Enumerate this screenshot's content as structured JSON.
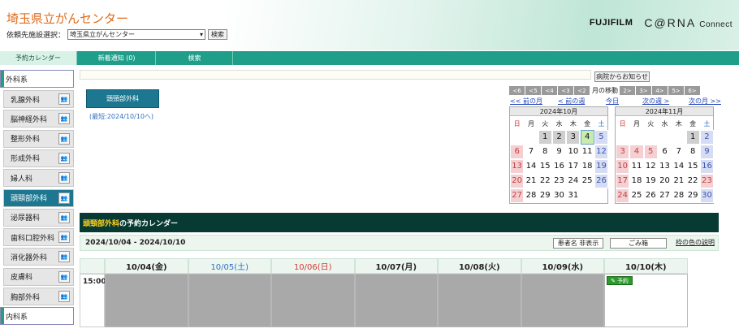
{
  "header": {
    "title": "埼玉県立がんセンター",
    "facility_label": "依頼先施設選択：",
    "facility_value": "埼玉県立がんセンター",
    "search_button": "検索",
    "logo_fujifilm": "FUJIFILM",
    "logo_corna": "C@RNA",
    "logo_connect": "Connect"
  },
  "tabs": [
    {
      "label": "予約カレンダー",
      "active": true
    },
    {
      "label": "新着通知 (0)",
      "active": false
    },
    {
      "label": "検索",
      "active": false
    }
  ],
  "sidebar": {
    "category_surgery": "外科系",
    "items": [
      {
        "label": "乳腺外科",
        "icon": "doctor-icon"
      },
      {
        "label": "脳神経外科",
        "icon": "doctor-icon"
      },
      {
        "label": "整形外科",
        "icon": "doctor-icon"
      },
      {
        "label": "形成外科",
        "icon": "doctor-icon"
      },
      {
        "label": "婦人科",
        "icon": "doctor-icon"
      },
      {
        "label": "頭頸部外科",
        "icon": "doctor-icon",
        "active": true
      },
      {
        "label": "泌尿器科",
        "icon": "doctor-icon"
      },
      {
        "label": "歯科口腔外科",
        "icon": "doctor-icon"
      },
      {
        "label": "消化器外科",
        "icon": "doctor-icon"
      },
      {
        "label": "皮膚科",
        "icon": "doctor-icon"
      },
      {
        "label": "胸部外科",
        "icon": "doctor-icon"
      }
    ],
    "category_internal": "内科系"
  },
  "notice_button": "病院からお知らせ",
  "dept_button": "頭頸部外科",
  "latest_text": "(最短:2024/10/10へ)",
  "month_nav": {
    "before": [
      "<6",
      "<5",
      "<4",
      "<3",
      "<2"
    ],
    "label": "月の移動",
    "after": [
      "2>",
      "3>",
      "4>",
      "5>",
      "6>"
    ],
    "prev_month": "<< 前の月",
    "prev_week": "< 前の週",
    "today": "今日",
    "next_week": "次の週 >",
    "next_month": "次の月 >>"
  },
  "weekdays": [
    "日",
    "月",
    "火",
    "水",
    "木",
    "金",
    "土"
  ],
  "mini_calendars": [
    {
      "title": "2024年10月",
      "weeks": [
        [
          "",
          "",
          "1",
          "2",
          "3",
          "4",
          "5"
        ],
        [
          "6",
          "7",
          "8",
          "9",
          "10",
          "11",
          "12"
        ],
        [
          "13",
          "14",
          "15",
          "16",
          "17",
          "18",
          "19"
        ],
        [
          "20",
          "21",
          "22",
          "23",
          "24",
          "25",
          "26"
        ],
        [
          "27",
          "28",
          "29",
          "30",
          "31",
          "",
          ""
        ]
      ],
      "today": "4"
    },
    {
      "title": "2024年11月",
      "weeks": [
        [
          "",
          "",
          "",
          "",
          "",
          "1",
          "2"
        ],
        [
          "3",
          "4",
          "5",
          "6",
          "7",
          "8",
          "9"
        ],
        [
          "10",
          "11",
          "12",
          "13",
          "14",
          "15",
          "16"
        ],
        [
          "17",
          "18",
          "19",
          "20",
          "21",
          "22",
          "23"
        ],
        [
          "24",
          "25",
          "26",
          "27",
          "28",
          "29",
          "30"
        ]
      ],
      "today": ""
    }
  ],
  "calendar": {
    "dept": "頭頸部外科",
    "title_suffix": "の予約カレンダー",
    "range": "2024/10/04 - 2024/10/10",
    "hide_patient_button": "患者名 非表示",
    "trash_button": "ごみ箱",
    "legend_link": "枠の色の説明",
    "days": [
      {
        "label": "10/04(金)",
        "type": "weekday",
        "open": false
      },
      {
        "label": "10/05(土)",
        "type": "sat",
        "open": false
      },
      {
        "label": "10/06(日)",
        "type": "sun",
        "open": false
      },
      {
        "label": "10/07(月)",
        "type": "weekday",
        "open": false
      },
      {
        "label": "10/08(火)",
        "type": "weekday",
        "open": false
      },
      {
        "label": "10/09(水)",
        "type": "weekday",
        "open": false
      },
      {
        "label": "10/10(木)",
        "type": "weekday",
        "open": true
      }
    ],
    "time": "15:00",
    "book_label": "予約"
  },
  "colors": {
    "accent": "#1f9f8a",
    "active_item": "#1d7791",
    "title_orange": "#e06a18",
    "sat_blue": "#2f6fc0",
    "sun_red": "#d03a3a"
  }
}
